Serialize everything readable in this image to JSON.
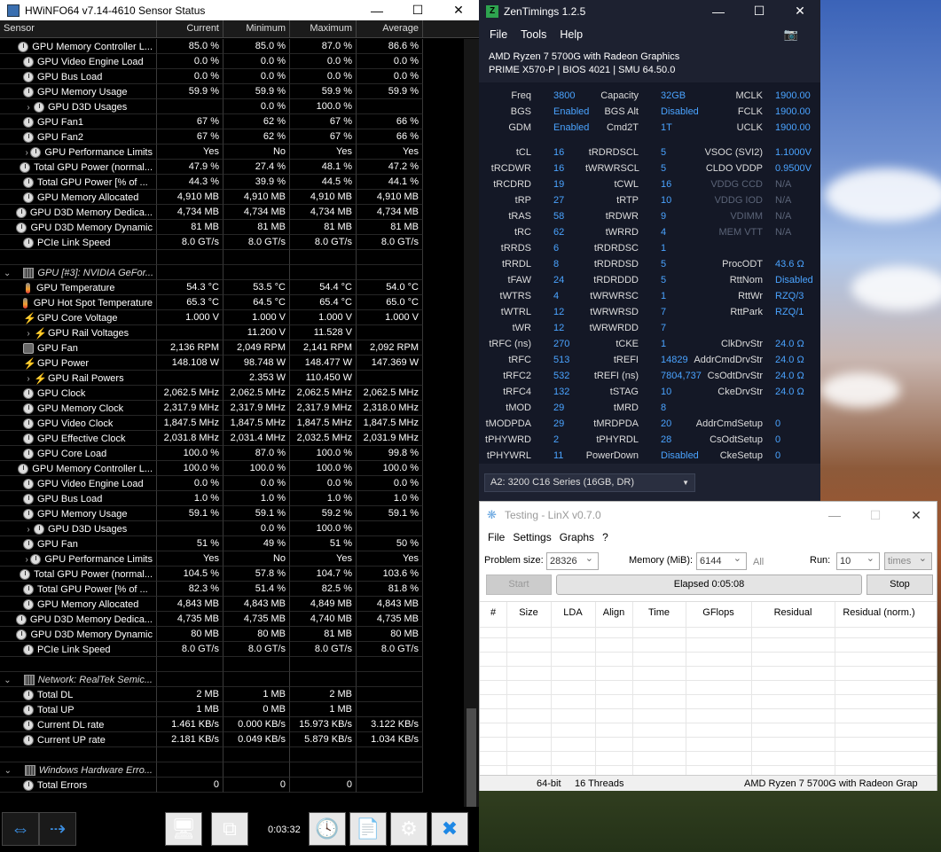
{
  "hwinfo": {
    "title": "HWiNFO64 v7.14-4610 Sensor Status",
    "headers": [
      "Sensor",
      "Current",
      "Minimum",
      "Maximum",
      "Average"
    ],
    "rows": [
      {
        "icon": "clock",
        "name": "GPU Memory Controller L...",
        "cur": "85.0 %",
        "min": "85.0 %",
        "max": "87.0 %",
        "avg": "86.6 %"
      },
      {
        "icon": "clock",
        "name": "GPU Video Engine Load",
        "cur": "0.0 %",
        "min": "0.0 %",
        "max": "0.0 %",
        "avg": "0.0 %"
      },
      {
        "icon": "clock",
        "name": "GPU Bus Load",
        "cur": "0.0 %",
        "min": "0.0 %",
        "max": "0.0 %",
        "avg": "0.0 %"
      },
      {
        "icon": "clock",
        "name": "GPU Memory Usage",
        "cur": "59.9 %",
        "min": "59.9 %",
        "max": "59.9 %",
        "avg": "59.9 %"
      },
      {
        "icon": "clock",
        "expand": true,
        "name": "GPU D3D Usages",
        "cur": "",
        "min": "0.0 %",
        "max": "100.0 %",
        "avg": ""
      },
      {
        "icon": "clock",
        "name": "GPU Fan1",
        "cur": "67 %",
        "min": "62 %",
        "max": "67 %",
        "avg": "66 %"
      },
      {
        "icon": "clock",
        "name": "GPU Fan2",
        "cur": "67 %",
        "min": "62 %",
        "max": "67 %",
        "avg": "66 %"
      },
      {
        "icon": "clock",
        "expand": true,
        "name": "GPU Performance Limits",
        "cur": "Yes",
        "min": "No",
        "max": "Yes",
        "avg": "Yes"
      },
      {
        "icon": "clock",
        "name": "Total GPU Power (normal...",
        "cur": "47.9 %",
        "min": "27.4 %",
        "max": "48.1 %",
        "avg": "47.2 %"
      },
      {
        "icon": "clock",
        "name": "Total GPU Power [% of ...",
        "cur": "44.3 %",
        "min": "39.9 %",
        "max": "44.5 %",
        "avg": "44.1 %"
      },
      {
        "icon": "clock",
        "name": "GPU Memory Allocated",
        "cur": "4,910 MB",
        "min": "4,910 MB",
        "max": "4,910 MB",
        "avg": "4,910 MB"
      },
      {
        "icon": "clock",
        "name": "GPU D3D Memory Dedica...",
        "cur": "4,734 MB",
        "min": "4,734 MB",
        "max": "4,734 MB",
        "avg": "4,734 MB"
      },
      {
        "icon": "clock",
        "name": "GPU D3D Memory Dynamic",
        "cur": "81 MB",
        "min": "81 MB",
        "max": "81 MB",
        "avg": "81 MB"
      },
      {
        "icon": "clock",
        "name": "PCIe Link Speed",
        "cur": "8.0 GT/s",
        "min": "8.0 GT/s",
        "max": "8.0 GT/s",
        "avg": "8.0 GT/s"
      },
      {
        "blank": true
      },
      {
        "group": true,
        "icon": "dev",
        "name": "GPU [#3]: NVIDIA GeFor..."
      },
      {
        "icon": "temp",
        "name": "GPU Temperature",
        "cur": "54.3 °C",
        "min": "53.5 °C",
        "max": "54.4 °C",
        "avg": "54.0 °C"
      },
      {
        "icon": "temp",
        "name": "GPU Hot Spot Temperature",
        "cur": "65.3 °C",
        "min": "64.5 °C",
        "max": "65.4 °C",
        "avg": "65.0 °C"
      },
      {
        "icon": "bolt",
        "name": "GPU Core Voltage",
        "cur": "1.000 V",
        "min": "1.000 V",
        "max": "1.000 V",
        "avg": "1.000 V"
      },
      {
        "icon": "bolt",
        "expand": true,
        "name": "GPU Rail Voltages",
        "cur": "",
        "min": "11.200 V",
        "max": "11.528 V",
        "avg": ""
      },
      {
        "icon": "fan",
        "name": "GPU Fan",
        "cur": "2,136 RPM",
        "min": "2,049 RPM",
        "max": "2,141 RPM",
        "avg": "2,092 RPM"
      },
      {
        "icon": "bolt",
        "name": "GPU Power",
        "cur": "148.108 W",
        "min": "98.748 W",
        "max": "148.477 W",
        "avg": "147.369 W"
      },
      {
        "icon": "bolt",
        "expand": true,
        "name": "GPU Rail Powers",
        "cur": "",
        "min": "2.353 W",
        "max": "110.450 W",
        "avg": ""
      },
      {
        "icon": "clock",
        "name": "GPU Clock",
        "cur": "2,062.5 MHz",
        "min": "2,062.5 MHz",
        "max": "2,062.5 MHz",
        "avg": "2,062.5 MHz"
      },
      {
        "icon": "clock",
        "name": "GPU Memory Clock",
        "cur": "2,317.9 MHz",
        "min": "2,317.9 MHz",
        "max": "2,317.9 MHz",
        "avg": "2,318.0 MHz"
      },
      {
        "icon": "clock",
        "name": "GPU Video Clock",
        "cur": "1,847.5 MHz",
        "min": "1,847.5 MHz",
        "max": "1,847.5 MHz",
        "avg": "1,847.5 MHz"
      },
      {
        "icon": "clock",
        "name": "GPU Effective Clock",
        "cur": "2,031.8 MHz",
        "min": "2,031.4 MHz",
        "max": "2,032.5 MHz",
        "avg": "2,031.9 MHz"
      },
      {
        "icon": "clock",
        "name": "GPU Core Load",
        "cur": "100.0 %",
        "min": "87.0 %",
        "max": "100.0 %",
        "avg": "99.8 %"
      },
      {
        "icon": "clock",
        "name": "GPU Memory Controller L...",
        "cur": "100.0 %",
        "min": "100.0 %",
        "max": "100.0 %",
        "avg": "100.0 %"
      },
      {
        "icon": "clock",
        "name": "GPU Video Engine Load",
        "cur": "0.0 %",
        "min": "0.0 %",
        "max": "0.0 %",
        "avg": "0.0 %"
      },
      {
        "icon": "clock",
        "name": "GPU Bus Load",
        "cur": "1.0 %",
        "min": "1.0 %",
        "max": "1.0 %",
        "avg": "1.0 %"
      },
      {
        "icon": "clock",
        "name": "GPU Memory Usage",
        "cur": "59.1 %",
        "min": "59.1 %",
        "max": "59.2 %",
        "avg": "59.1 %"
      },
      {
        "icon": "clock",
        "expand": true,
        "name": "GPU D3D Usages",
        "cur": "",
        "min": "0.0 %",
        "max": "100.0 %",
        "avg": ""
      },
      {
        "icon": "clock",
        "name": "GPU Fan",
        "cur": "51 %",
        "min": "49 %",
        "max": "51 %",
        "avg": "50 %"
      },
      {
        "icon": "clock",
        "expand": true,
        "name": "GPU Performance Limits",
        "cur": "Yes",
        "min": "No",
        "max": "Yes",
        "avg": "Yes"
      },
      {
        "icon": "clock",
        "name": "Total GPU Power (normal...",
        "cur": "104.5 %",
        "min": "57.8 %",
        "max": "104.7 %",
        "avg": "103.6 %"
      },
      {
        "icon": "clock",
        "name": "Total GPU Power [% of ...",
        "cur": "82.3 %",
        "min": "51.4 %",
        "max": "82.5 %",
        "avg": "81.8 %"
      },
      {
        "icon": "clock",
        "name": "GPU Memory Allocated",
        "cur": "4,843 MB",
        "min": "4,843 MB",
        "max": "4,849 MB",
        "avg": "4,843 MB"
      },
      {
        "icon": "clock",
        "name": "GPU D3D Memory Dedica...",
        "cur": "4,735 MB",
        "min": "4,735 MB",
        "max": "4,740 MB",
        "avg": "4,735 MB"
      },
      {
        "icon": "clock",
        "name": "GPU D3D Memory Dynamic",
        "cur": "80 MB",
        "min": "80 MB",
        "max": "81 MB",
        "avg": "80 MB"
      },
      {
        "icon": "clock",
        "name": "PCIe Link Speed",
        "cur": "8.0 GT/s",
        "min": "8.0 GT/s",
        "max": "8.0 GT/s",
        "avg": "8.0 GT/s"
      },
      {
        "blank": true
      },
      {
        "group": true,
        "icon": "dev",
        "name": "Network: RealTek Semic..."
      },
      {
        "icon": "clock",
        "name": "Total DL",
        "cur": "2 MB",
        "min": "1 MB",
        "max": "2 MB",
        "avg": ""
      },
      {
        "icon": "clock",
        "name": "Total UP",
        "cur": "1 MB",
        "min": "0 MB",
        "max": "1 MB",
        "avg": ""
      },
      {
        "icon": "clock",
        "name": "Current DL rate",
        "cur": "1.461 KB/s",
        "min": "0.000 KB/s",
        "max": "15.973 KB/s",
        "avg": "3.122 KB/s"
      },
      {
        "icon": "clock",
        "name": "Current UP rate",
        "cur": "2.181 KB/s",
        "min": "0.049 KB/s",
        "max": "5.879 KB/s",
        "avg": "1.034 KB/s"
      },
      {
        "blank": true
      },
      {
        "group": true,
        "icon": "dev",
        "name": "Windows Hardware Erro..."
      },
      {
        "icon": "clock",
        "name": "Total Errors",
        "cur": "0",
        "min": "0",
        "max": "0",
        "avg": ""
      }
    ],
    "timer": "0:03:32"
  },
  "zen": {
    "title": "ZenTimings 1.2.5",
    "menu": [
      "File",
      "Tools",
      "Help"
    ],
    "cpu": "AMD Ryzen 7 5700G with Radeon Graphics",
    "board": "PRIME X570-P | BIOS 4021 | SMU 64.50.0",
    "top": [
      [
        "Freq",
        "3800",
        "Capacity",
        "32GB",
        "MCLK",
        "1900.00"
      ],
      [
        "BGS",
        "Enabled",
        "BGS Alt",
        "Disabled",
        "FCLK",
        "1900.00"
      ],
      [
        "GDM",
        "Enabled",
        "Cmd2T",
        "1T",
        "UCLK",
        "1900.00"
      ]
    ],
    "timings": [
      [
        "tCL",
        "16",
        "tRDRDSCL",
        "5",
        "VSOC (SVI2)",
        "1.1000V"
      ],
      [
        "tRCDWR",
        "16",
        "tWRWRSCL",
        "5",
        "CLDO VDDP",
        "0.9500V"
      ],
      [
        "tRCDRD",
        "19",
        "tCWL",
        "16",
        "VDDG CCD",
        "N/A"
      ],
      [
        "tRP",
        "27",
        "tRTP",
        "10",
        "VDDG IOD",
        "N/A"
      ],
      [
        "tRAS",
        "58",
        "tRDWR",
        "9",
        "VDIMM",
        "N/A"
      ],
      [
        "tRC",
        "62",
        "tWRRD",
        "4",
        "MEM VTT",
        "N/A"
      ],
      [
        "tRRDS",
        "6",
        "tRDRDSC",
        "1",
        "",
        ""
      ],
      [
        "tRRDL",
        "8",
        "tRDRDSD",
        "5",
        "ProcODT",
        "43.6 Ω"
      ],
      [
        "tFAW",
        "24",
        "tRDRDDD",
        "5",
        "RttNom",
        "Disabled"
      ],
      [
        "tWTRS",
        "4",
        "tWRWRSC",
        "1",
        "RttWr",
        "RZQ/3"
      ],
      [
        "tWTRL",
        "12",
        "tWRWRSD",
        "7",
        "RttPark",
        "RZQ/1"
      ],
      [
        "tWR",
        "12",
        "tWRWRDD",
        "7",
        "",
        ""
      ],
      [
        "tRFC (ns)",
        "270",
        "tCKE",
        "1",
        "ClkDrvStr",
        "24.0 Ω"
      ],
      [
        "tRFC",
        "513",
        "tREFI",
        "14829",
        "AddrCmdDrvStr",
        "24.0 Ω"
      ],
      [
        "tRFC2",
        "532",
        "tREFI (ns)",
        "7804,737",
        "CsOdtDrvStr",
        "24.0 Ω"
      ],
      [
        "tRFC4",
        "132",
        "tSTAG",
        "10",
        "CkeDrvStr",
        "24.0 Ω"
      ],
      [
        "tMOD",
        "29",
        "tMRD",
        "8",
        "",
        ""
      ],
      [
        "tMODPDA",
        "29",
        "tMRDPDA",
        "20",
        "AddrCmdSetup",
        "0"
      ],
      [
        "tPHYWRD",
        "2",
        "tPHYRDL",
        "28",
        "CsOdtSetup",
        "0"
      ],
      [
        "tPHYWRL",
        "11",
        "PowerDown",
        "Disabled",
        "CkeSetup",
        "0"
      ]
    ],
    "profile": "A2: 3200 C16 Series (16GB, DR)"
  },
  "linx": {
    "title": "Testing - LinX v0.7.0",
    "menu": [
      "File",
      "Settings",
      "Graphs",
      "?"
    ],
    "problem_label": "Problem size:",
    "problem_value": "28326",
    "memory_label": "Memory (MiB):",
    "memory_value": "6144",
    "all_label": "All",
    "run_label": "Run:",
    "run_value": "10",
    "run_unit": "times",
    "start": "Start",
    "elapsed": "Elapsed 0:05:08",
    "stop": "Stop",
    "columns": [
      "#",
      "Size",
      "LDA",
      "Align",
      "Time",
      "GFlops",
      "Residual",
      "Residual (norm.)"
    ],
    "status": [
      "64-bit",
      "16 Threads",
      "AMD Ryzen 7 5700G with Radeon Grap"
    ]
  }
}
